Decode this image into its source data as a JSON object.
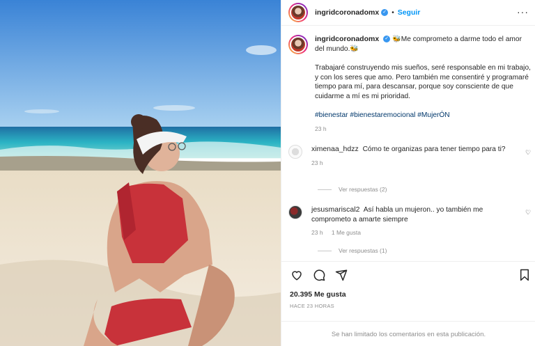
{
  "header": {
    "username": "ingridcoronadomx",
    "separator": "•",
    "follow_label": "Seguir",
    "more_icon": "···"
  },
  "caption": {
    "username": "ingridcoronadomx",
    "line1": "🐝Me comprometo a darme todo el amor del mundo.🐝",
    "paragraph": "Trabajaré construyendo mis sueños, seré responsable en mi trabajo, y con los seres que amo. Pero también me consentiré y programaré tiempo para mí, para descansar, porque soy consciente de que cuidarme a mí es mi prioridad.",
    "hashtags": "#bienestar #bienestaremocional #MujerÓN",
    "time": "23 h"
  },
  "comments": [
    {
      "username": "ximenaa_hdzz",
      "text": "Cómo te organizas para tener tiempo para ti?",
      "time": "23 h",
      "likes": "",
      "replies": "Ver respuestas (2)"
    },
    {
      "username": "jesusmariscal2",
      "text": "Así habla un mujeron.. yo también me comprometo a amarte siempre",
      "time": "23 h",
      "likes": "1 Me gusta",
      "replies": "Ver respuestas (1)"
    }
  ],
  "actions": {
    "likes": "20.395 Me gusta",
    "ago": "HACE 23 HORAS",
    "limited": "Se han limitado los comentarios en esta publicación."
  },
  "icons": {
    "like": "heart-icon",
    "comment": "comment-icon",
    "share": "share-icon",
    "save": "bookmark-icon"
  },
  "colors": {
    "link": "#0095f6",
    "hashtag": "#00376b",
    "muted": "#8e8e8e",
    "border": "#efefef"
  }
}
